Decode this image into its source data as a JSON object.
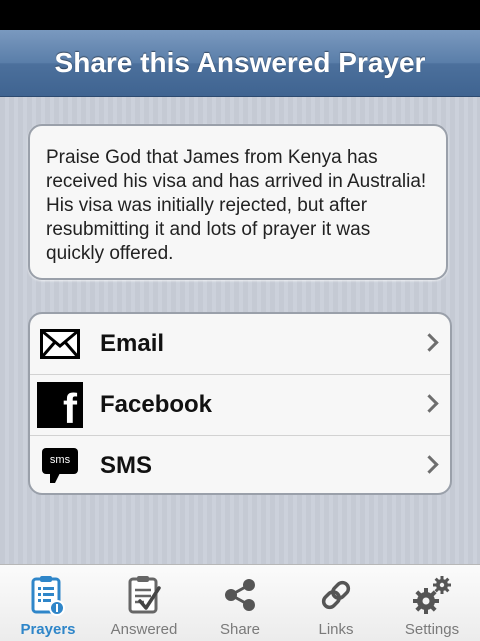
{
  "nav": {
    "title": "Share this Answered Prayer"
  },
  "prayer": {
    "text": "Praise God that James from Kenya has received his visa and has arrived in Australia! His visa was initially rejected, but after resubmitting it and lots of prayer it was quickly offered."
  },
  "share": {
    "items": [
      {
        "label": "Email",
        "icon": "envelope-icon"
      },
      {
        "label": "Facebook",
        "icon": "facebook-icon"
      },
      {
        "label": "SMS",
        "icon": "sms-icon",
        "icon_text": "sms"
      }
    ]
  },
  "tabs": {
    "items": [
      {
        "label": "Prayers",
        "icon": "prayer-list-icon",
        "active": true
      },
      {
        "label": "Answered",
        "icon": "clipboard-check-icon",
        "active": false
      },
      {
        "label": "Share",
        "icon": "share-icon",
        "active": false
      },
      {
        "label": "Links",
        "icon": "link-icon",
        "active": false
      },
      {
        "label": "Settings",
        "icon": "gears-icon",
        "active": false
      }
    ]
  },
  "colors": {
    "nav_bar": "#4c709c",
    "active_tab": "#2f86c9",
    "inactive_tab": "#7a7a7a"
  }
}
